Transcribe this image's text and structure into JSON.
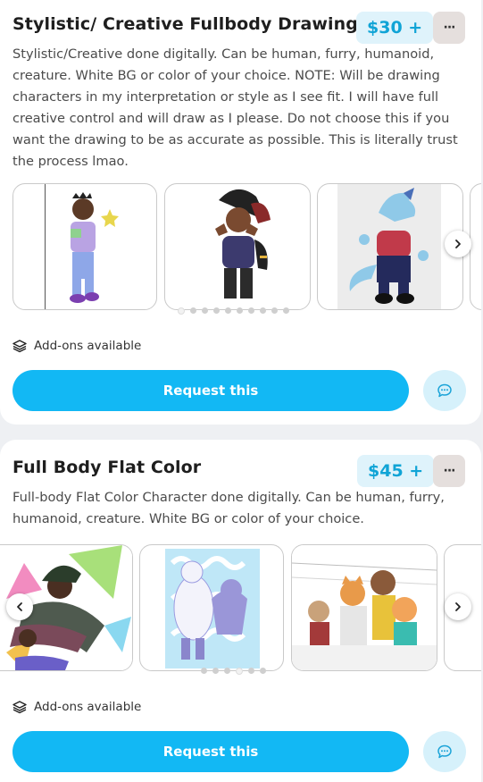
{
  "cards": [
    {
      "title": "Stylistic/ Creative Fullbody Drawings",
      "price": "$30 +",
      "more_label": "···",
      "description": "Stylistic/Creative done digitally. Can be human, furry, humanoid, creature. White BG or color of your choice. NOTE: Will be drawing characters in my interpretation or style as I see fit. I will have full creative control and will draw as I please. Do not choose this if you want the drawing to be as accurate as possible. This is literally trust the process lmao.",
      "gallery_dot_count": 10,
      "addons_label": "Add-ons available",
      "request_label": "Request this"
    },
    {
      "title": "Full Body Flat Color",
      "price": "$45 +",
      "more_label": "···",
      "description": "Full-body Flat Color Character done digitally. Can be human, furry, humanoid, creature. White BG or color of your choice.",
      "gallery_dot_count": 6,
      "addons_label": "Add-ons available",
      "request_label": "Request this"
    }
  ],
  "icons": {
    "more": "ellipsis-icon",
    "addons": "layers-icon",
    "chat": "chat-bubble-icon",
    "next": "chevron-right-icon",
    "prev": "chevron-left-icon"
  },
  "colors": {
    "accent": "#12b8f4",
    "price_bg": "#dff3fb",
    "price_text": "#10a4d6",
    "chat_bg": "#d6f1fb"
  }
}
